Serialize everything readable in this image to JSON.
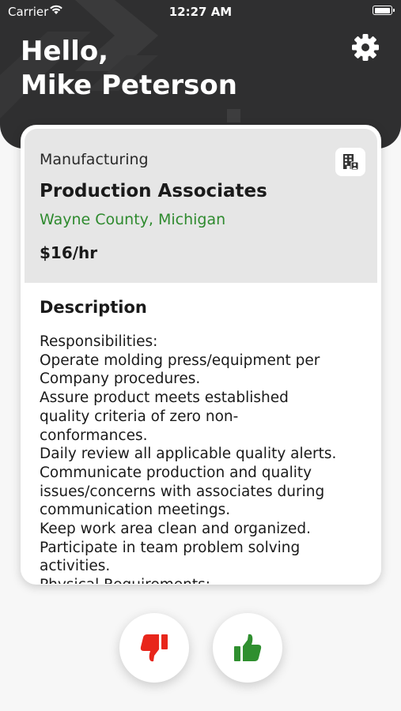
{
  "status_bar": {
    "carrier": "Carrier",
    "time": "12:27 AM"
  },
  "header": {
    "greeting_line1": "Hello,",
    "greeting_line2": "Mike Peterson"
  },
  "job": {
    "category": "Manufacturing",
    "title": "Production Associates",
    "location": "Wayne County, Michigan",
    "pay": "$16/hr",
    "description_heading": "Description",
    "description_lines": [
      "Responsibilities:",
      "Operate molding press/equipment per",
      "Company procedures.",
      "Assure product meets established",
      "quality criteria of zero non-",
      "conformances.",
      "Daily review all applicable quality alerts.",
      "Communicate production and quality",
      "issues/concerns with associates during",
      "communication meetings.",
      "Keep work area clean and organized.",
      "Participate in team problem solving",
      "activities.",
      "Physical Requirements:"
    ]
  },
  "icons": {
    "settings": "gear-icon",
    "company": "building-icon",
    "dislike": "thumbs-down-icon",
    "like": "thumbs-up-icon"
  },
  "colors": {
    "header_bg": "#2f2f30",
    "location_green": "#2e8a2e",
    "dislike_red": "#e8261b",
    "like_green": "#2f8f2f"
  }
}
